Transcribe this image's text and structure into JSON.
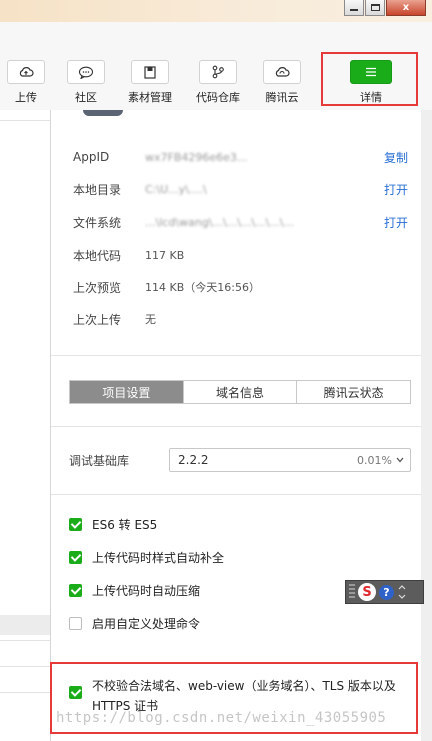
{
  "window": {
    "close_glyph": "x"
  },
  "toolbar": {
    "items": [
      {
        "label": "上传",
        "icon": "cloud-upload-icon"
      },
      {
        "label": "社区",
        "icon": "chat-bubble-icon"
      },
      {
        "label": "素材管理",
        "icon": "folder-icon"
      },
      {
        "label": "代码仓库",
        "icon": "git-branch-icon"
      },
      {
        "label": "腾讯云",
        "icon": "cloud-icon"
      },
      {
        "label": "详情",
        "icon": "menu-icon"
      }
    ],
    "accent": "#1aad19",
    "highlight_color": "#e63a3a"
  },
  "details": {
    "appid": {
      "key": "AppID",
      "value": "wx7FB4296e6e3...",
      "action": "复制"
    },
    "local_dir": {
      "key": "本地目录",
      "value": "C:\\U...y\\....\\",
      "action": "打开"
    },
    "file_system": {
      "key": "文件系统",
      "value": "...\\lcd\\wang\\...\\...\\...\\...\\...\\...",
      "action": "打开"
    },
    "local_code": {
      "key": "本地代码",
      "value": "117 KB"
    },
    "last_preview": {
      "key": "上次预览",
      "value": "114 KB（今天16:56）"
    },
    "last_upload": {
      "key": "上次上传",
      "value": "无"
    }
  },
  "tabs": [
    {
      "label": "项目设置",
      "active": true
    },
    {
      "label": "域名信息",
      "active": false
    },
    {
      "label": "腾讯云状态",
      "active": false
    }
  ],
  "library": {
    "label": "调试基础库",
    "version": "2.2.2",
    "percent": "0.01%"
  },
  "checkboxes": [
    {
      "label": "ES6 转 ES5",
      "checked": true
    },
    {
      "label": "上传代码时样式自动补全",
      "checked": true
    },
    {
      "label": "上传代码时自动压缩",
      "checked": true
    },
    {
      "label": "启用自定义处理命令",
      "checked": false
    }
  ],
  "last_checkbox": {
    "label": "不校验合法域名、web-view（业务域名）、TLS 版本以及 HTTPS 证书",
    "checked": true
  },
  "ime": {
    "logo": "S",
    "help": "?"
  },
  "watermark": "https://blog.csdn.net/weixin_43055905"
}
